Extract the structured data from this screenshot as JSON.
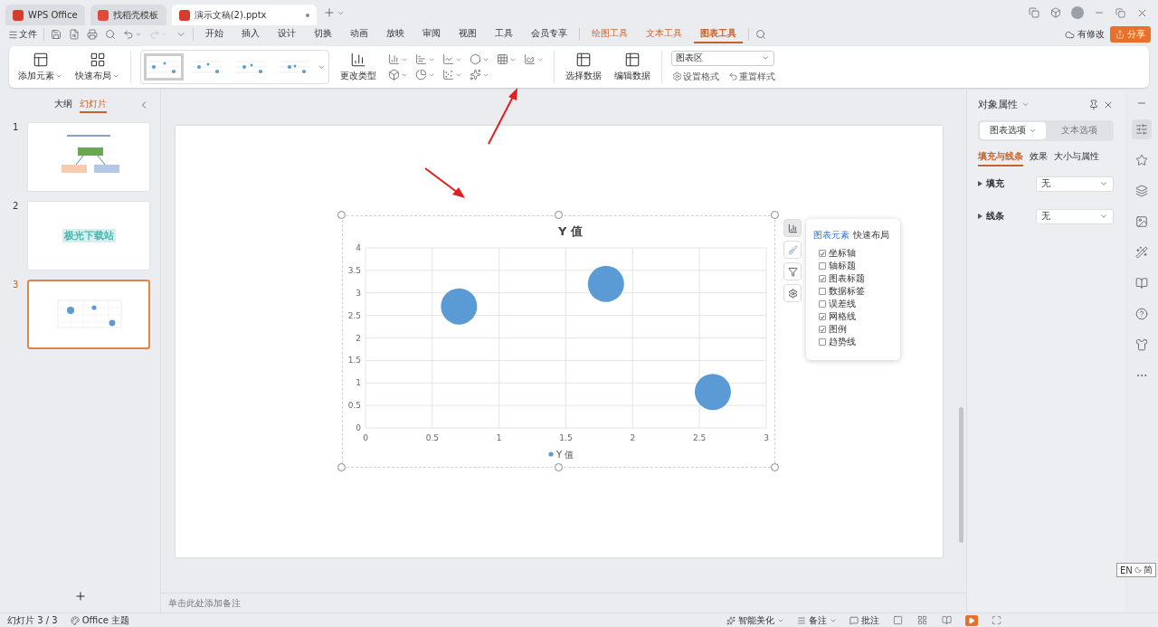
{
  "tabs": [
    {
      "label": "WPS Office",
      "kind": "home",
      "selected": false
    },
    {
      "label": "找稻壳模板",
      "kind": "docer",
      "selected": false
    },
    {
      "label": "演示文稿(2).pptx",
      "kind": "doc",
      "selected": true
    }
  ],
  "menu": {
    "file": "文件",
    "items": [
      {
        "label": "开始",
        "kind": "plain",
        "selected": false
      },
      {
        "label": "插入",
        "kind": "plain",
        "selected": false
      },
      {
        "label": "设计",
        "kind": "plain",
        "selected": false
      },
      {
        "label": "切换",
        "kind": "plain",
        "selected": false
      },
      {
        "label": "动画",
        "kind": "plain",
        "selected": false
      },
      {
        "label": "放映",
        "kind": "plain",
        "selected": false
      },
      {
        "label": "审阅",
        "kind": "plain",
        "selected": false
      },
      {
        "label": "视图",
        "kind": "plain",
        "selected": false
      },
      {
        "label": "工具",
        "kind": "plain",
        "selected": false
      },
      {
        "label": "会员专享",
        "kind": "plain",
        "selected": false
      },
      {
        "label": "绘图工具",
        "kind": "tool",
        "selected": false
      },
      {
        "label": "文本工具",
        "kind": "tool",
        "selected": false
      },
      {
        "label": "图表工具",
        "kind": "tool",
        "selected": true
      }
    ],
    "save_status": "有修改",
    "share": "分享"
  },
  "ribbon": {
    "add_element": "添加元素",
    "quick_layout": "快速布局",
    "styles": [
      {
        "selected": true
      },
      {
        "selected": false
      },
      {
        "selected": false
      },
      {
        "selected": false
      }
    ],
    "change_type": "更改类型",
    "select_data": "选择数据",
    "edit_data": "编辑数据",
    "element_select": "图表区",
    "set_format": "设置格式",
    "reset_style": "重置样式"
  },
  "left_panel": {
    "tabs": [
      {
        "label": "大纲",
        "selected": false
      },
      {
        "label": "幻灯片",
        "selected": true
      }
    ],
    "slides": [
      {
        "number": "1",
        "kind": "diagram",
        "selected": false
      },
      {
        "number": "2",
        "kind": "text",
        "text": "极光下载站",
        "selected": false
      },
      {
        "number": "3",
        "kind": "chart",
        "selected": true
      }
    ]
  },
  "chart": {
    "chart_data": {
      "type": "scatter",
      "title": "Y 值",
      "x": [
        0.7,
        1.8,
        2.6
      ],
      "series": [
        {
          "name": "Y 值",
          "color": "#5b9bd5",
          "values": [
            2.7,
            3.2,
            0.8
          ],
          "marker": "circle"
        }
      ],
      "grid": true,
      "xlim": [
        0,
        3
      ],
      "ylim": [
        0,
        4
      ],
      "xticks": [
        0,
        0.5,
        1,
        1.5,
        2,
        2.5,
        3
      ],
      "yticks": [
        0,
        0.5,
        1,
        1.5,
        2,
        2.5,
        3,
        3.5,
        4
      ]
    }
  },
  "chart_elements_popup": {
    "tabs": [
      {
        "label": "图表元素",
        "selected": true
      },
      {
        "label": "快速布局",
        "selected": false
      }
    ],
    "items": [
      {
        "label": "坐标轴",
        "checked": true
      },
      {
        "label": "轴标题",
        "checked": false
      },
      {
        "label": "图表标题",
        "checked": true
      },
      {
        "label": "数据标签",
        "checked": false
      },
      {
        "label": "误差线",
        "checked": false
      },
      {
        "label": "网格线",
        "checked": true
      },
      {
        "label": "图例",
        "checked": true
      },
      {
        "label": "趋势线",
        "checked": false
      }
    ]
  },
  "notes_placeholder": "单击此处添加备注",
  "properties": {
    "title": "对象属性",
    "tabs": [
      {
        "label": "图表选项",
        "selected": true
      },
      {
        "label": "文本选项",
        "selected": false
      }
    ],
    "subtabs": [
      {
        "label": "填充与线条",
        "selected": true
      },
      {
        "label": "效果",
        "selected": false
      },
      {
        "label": "大小与属性",
        "selected": false
      }
    ],
    "rows": [
      {
        "label": "填充",
        "value": "无"
      },
      {
        "label": "线条",
        "value": "无"
      }
    ]
  },
  "ime_badge": {
    "language": "EN",
    "mode": "简"
  },
  "status_bar": {
    "slide_count": "幻灯片 3 / 3",
    "theme": "Office 主题",
    "beautify": "智能美化",
    "notes": "备注",
    "comments": "批注"
  }
}
